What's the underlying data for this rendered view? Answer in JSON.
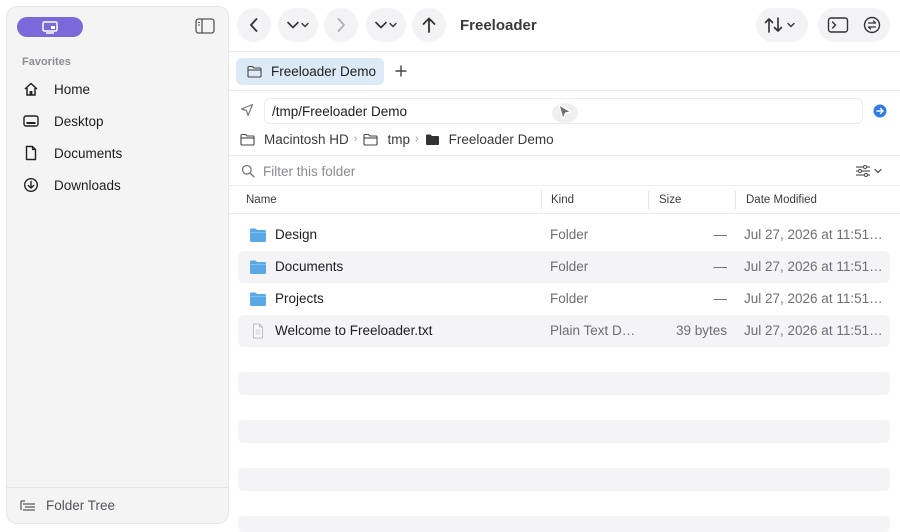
{
  "sidebar": {
    "heading": "Favorites",
    "items": [
      {
        "label": "Home",
        "icon": "house-icon"
      },
      {
        "label": "Desktop",
        "icon": "desktop-icon"
      },
      {
        "label": "Documents",
        "icon": "document-icon"
      },
      {
        "label": "Downloads",
        "icon": "download-icon"
      }
    ],
    "footer_label": "Folder Tree",
    "accent": "#7b68d9"
  },
  "toolbar": {
    "title": "Freeloader"
  },
  "tabs": [
    {
      "label": "Freeloader Demo",
      "active": true
    }
  ],
  "address": {
    "path": "/tmp/Freeloader Demo",
    "breadcrumbs": [
      "Macintosh HD",
      "tmp",
      "Freeloader Demo"
    ]
  },
  "filter": {
    "placeholder": "Filter this folder"
  },
  "columns": {
    "name": "Name",
    "kind": "Kind",
    "size": "Size",
    "date": "Date Modified"
  },
  "files": [
    {
      "name": "Design",
      "kind": "Folder",
      "size": "—",
      "date": "Jul 27, 2026 at 11:51…",
      "icon": "folder-icon"
    },
    {
      "name": "Documents",
      "kind": "Folder",
      "size": "—",
      "date": "Jul 27, 2026 at 11:51…",
      "icon": "folder-icon"
    },
    {
      "name": "Projects",
      "kind": "Folder",
      "size": "—",
      "date": "Jul 27, 2026 at 11:51…",
      "icon": "folder-icon"
    },
    {
      "name": "Welcome to Freeloader.txt",
      "kind": "Plain Text Do…",
      "size": "39 bytes",
      "date": "Jul 27, 2026 at 11:51…",
      "icon": "text-file-icon"
    }
  ],
  "colors": {
    "tab_active": "#dceaf7",
    "folder_blue": "#5aa9e6",
    "go_button": "#2f7de1",
    "row_stripe": "#f4f4f6"
  }
}
